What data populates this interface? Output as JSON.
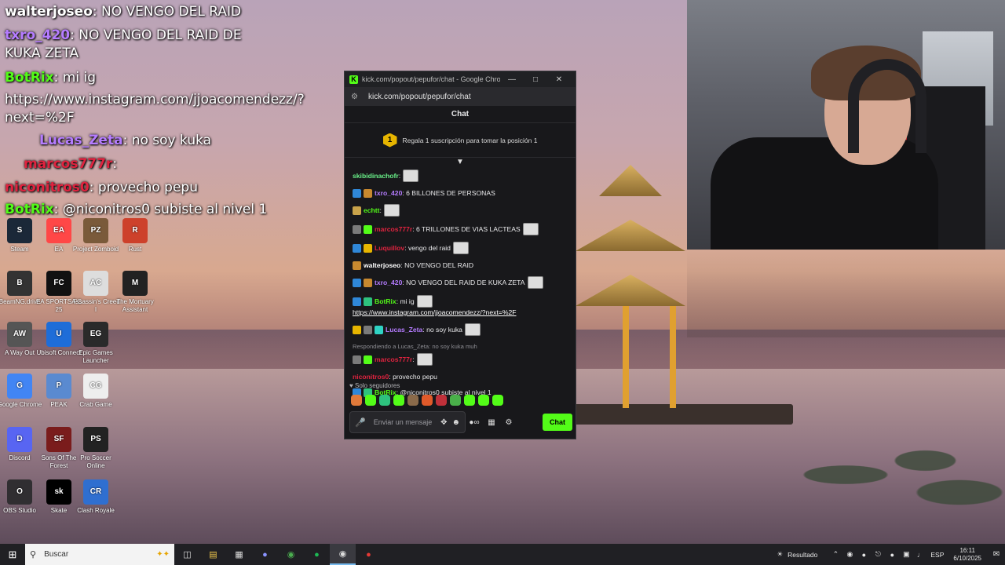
{
  "overlay": [
    {
      "user": "walterjoseo",
      "text": ": NO VENGO DEL RAID"
    },
    {
      "user": "txro_420",
      "text": ": NO VENGO DEL RAID DE"
    },
    {
      "user": "",
      "text": "KUKA ZETA"
    },
    {
      "user": "BotRix",
      "text": ": mi ig"
    },
    {
      "user": "",
      "text": "https://www.instagram.com/jjoacomendezz/?"
    },
    {
      "user": "",
      "text": "next=%2F"
    },
    {
      "user": "Lucas_Zeta",
      "text": ": no soy kuka"
    },
    {
      "user": "marcos777r",
      "text": ":"
    },
    {
      "user": "niconitros0",
      "text": ": provecho pepu"
    },
    {
      "user": "BotRix",
      "text": ": @niconitros0 subiste al nivel 1"
    }
  ],
  "desktop_icons": [
    {
      "label": "Steam",
      "color": "#1b2838",
      "glyph": "S"
    },
    {
      "label": "EA",
      "color": "#ff4747",
      "glyph": "EA"
    },
    {
      "label": "Project Zomboid",
      "color": "#7a5a3a",
      "glyph": "PZ"
    },
    {
      "label": "Rust",
      "color": "#cd412b",
      "glyph": "R"
    },
    {
      "label": "BeamNG.drive",
      "color": "#333",
      "glyph": "B"
    },
    {
      "label": "EA SPORTS FC 25",
      "color": "#111",
      "glyph": "FC"
    },
    {
      "label": "Assassin's Creed I",
      "color": "#ddd",
      "glyph": "AC"
    },
    {
      "label": "The Mortuary Assistant",
      "color": "#222",
      "glyph": "M"
    },
    {
      "label": "A Way Out",
      "color": "#555",
      "glyph": "AW"
    },
    {
      "label": "Ubisoft Connect",
      "color": "#1e6dd8",
      "glyph": "U"
    },
    {
      "label": "Epic Games Launcher",
      "color": "#2a2a2a",
      "glyph": "EG"
    },
    {
      "label": "Google Chrome",
      "color": "#4285f4",
      "glyph": "G"
    },
    {
      "label": "PEAK",
      "color": "#5a8ad0",
      "glyph": "P"
    },
    {
      "label": "Crab Game",
      "color": "#eee",
      "glyph": "CG"
    },
    {
      "label": "Discord",
      "color": "#5865f2",
      "glyph": "D"
    },
    {
      "label": "Sons Of The Forest",
      "color": "#7a1c1c",
      "glyph": "SF"
    },
    {
      "label": "Pro Soccer Online",
      "color": "#222",
      "glyph": "PS"
    },
    {
      "label": "OBS Studio",
      "color": "#302e31",
      "glyph": "O"
    },
    {
      "label": "Skate",
      "color": "#000",
      "glyph": "sk"
    },
    {
      "label": "Clash Royale",
      "color": "#2f6fd0",
      "glyph": "CR"
    }
  ],
  "popup": {
    "title": "kick.com/popout/pepufor/chat - Google Chrome",
    "url": "kick.com/popout/pepufor/chat",
    "header": "Chat",
    "sub_rank": "1",
    "sub_text": "Regala 1 suscripción para tomar la posición 1",
    "pinned_icon": "pin-icon",
    "followers_only": "Solo seguidores",
    "input_placeholder": "Enviar un mensaje",
    "send_label": "Chat"
  },
  "messages": [
    {
      "user": "skibidinachofr",
      "color": "#6af28a",
      "text": ":",
      "emote": true,
      "badges": []
    },
    {
      "user": "txro_420",
      "color": "#b57cff",
      "text": ": 6 BILLONES DE PERSONAS",
      "emote": false,
      "badges": [
        "#2f87d8",
        "#c8892f"
      ]
    },
    {
      "user": "echtt",
      "color": "#53fc18",
      "text": ":",
      "emote": true,
      "badges": [
        "#c8a24a"
      ]
    },
    {
      "user": "marcos777r",
      "color": "#e0233f",
      "text": ": 6 TRILLONES DE VIAS LACTEAS",
      "emote": true,
      "badges": [
        "#7a7a7a",
        "#53fc18"
      ]
    },
    {
      "user": "Luquillov",
      "color": "#e0233f",
      "text": ": vengo del raid",
      "emote": true,
      "badges": [
        "#2f87d8",
        "#e7b500"
      ]
    },
    {
      "user": "walterjoseo",
      "color": "#ffffff",
      "text": ": NO VENGO DEL RAID",
      "emote": false,
      "badges": [
        "#c8892f"
      ]
    },
    {
      "user": "txro_420",
      "color": "#b57cff",
      "text": ": NO VENGO DEL RAID DE KUKA ZETA",
      "emote": true,
      "badges": [
        "#2f87d8",
        "#c8892f"
      ]
    },
    {
      "user": "BotRix",
      "color": "#53fc18",
      "text": ": mi ig",
      "emote": true,
      "badges": [
        "#2f87d8",
        "#2ec27e"
      ],
      "link": "https://www.instagram.com/jjoacomendezz/?next=%2F"
    },
    {
      "user": "Lucas_Zeta",
      "color": "#b57cff",
      "text": ": no soy kuka",
      "emote": true,
      "badges": [
        "#e7b500",
        "#7a7a7a",
        "#2fd3c4"
      ]
    },
    {
      "user": "marcos777r",
      "color": "#e0233f",
      "text": ":",
      "emote": true,
      "badges": [
        "#7a7a7a",
        "#53fc18"
      ],
      "reply": "Respondiendo a Lucas_Zeta: no soy kuka muh"
    },
    {
      "user": "niconitros0",
      "color": "#e0233f",
      "text": ": provecho pepu",
      "emote": false,
      "badges": []
    },
    {
      "user": "BotRix",
      "color": "#53fc18",
      "text": ": @niconitros0 subiste al nivel 1",
      "emote": false,
      "badges": [
        "#2f87d8",
        "#2ec27e"
      ]
    }
  ],
  "taskbar": {
    "search_placeholder": "Buscar",
    "weather": "Resultado",
    "lang": "ESP",
    "time": "16:11",
    "date": "6/10/2025"
  }
}
